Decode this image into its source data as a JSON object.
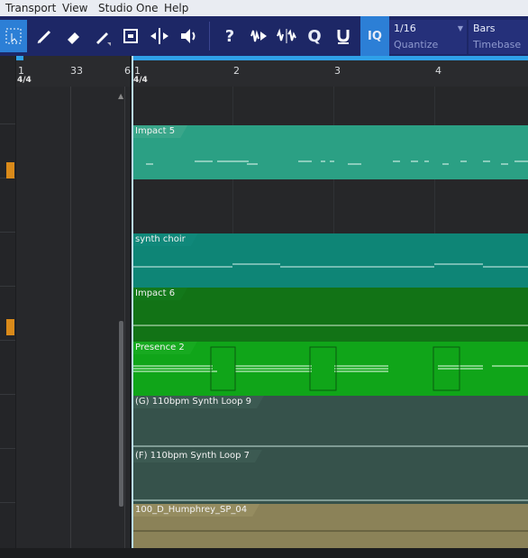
{
  "menu": {
    "transport": "Transport",
    "view": "View",
    "studio_one": "Studio One",
    "help": "Help"
  },
  "toolbar": {
    "quantize_value": "1/16",
    "quantize_label": "Quantize",
    "timebase_value": "Bars",
    "timebase_label": "Timebase",
    "iq_label": "IQ",
    "help_label": "?",
    "q_label": "Q"
  },
  "ruler": {
    "left_numbers": [
      "1",
      "33",
      "6"
    ],
    "main_numbers": [
      "1",
      "2",
      "3",
      "4"
    ],
    "time_signature": "4/4"
  },
  "tracks": [
    {
      "name": "Impact 5",
      "color": "#2ba084",
      "tab_color": "#3aa68a"
    },
    {
      "name": "synth choir",
      "color": "#0e8576",
      "tab_color": "#10887a"
    },
    {
      "name": "Impact 6",
      "color": "#127316",
      "tab_color": "#13781a"
    },
    {
      "name": "Presence 2",
      "color": "#10a519",
      "tab_color": "#17aa20"
    },
    {
      "name": "(G) 110bpm Synth Loop 9",
      "color": "#36524b",
      "tab_color": "#3c5a52"
    },
    {
      "name": "(F) 110bpm Synth Loop 7",
      "color": "#36524b",
      "tab_color": "#3c5a52"
    },
    {
      "name": "100_D_Humphrey_SP_04",
      "color": "#8b8258",
      "tab_color": "#958c60"
    }
  ]
}
